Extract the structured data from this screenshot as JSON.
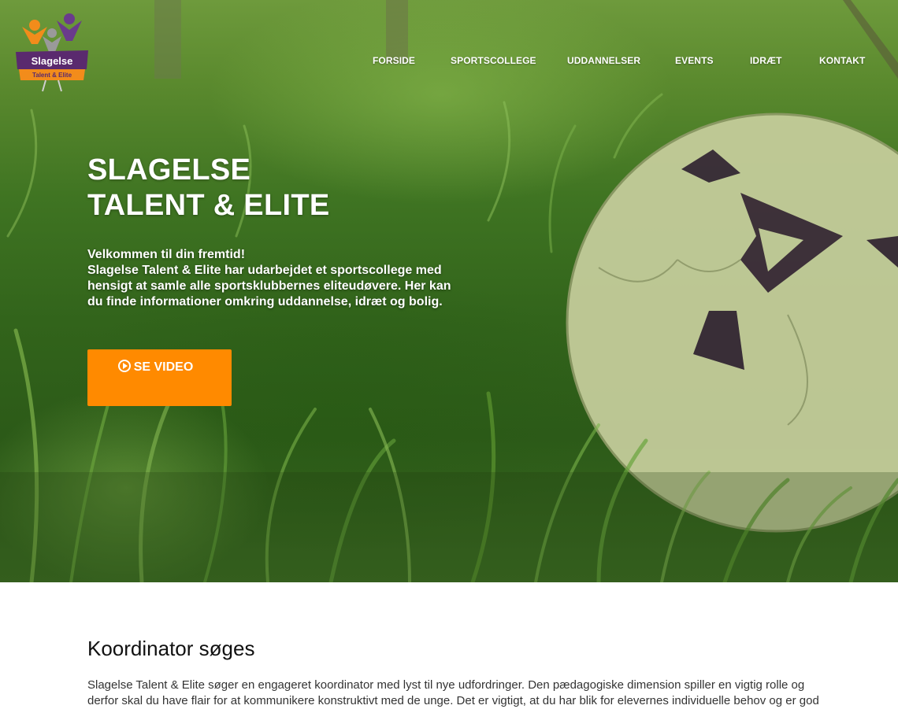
{
  "brand": {
    "logo_name": "Slagelse",
    "logo_sub": "Talent & Elite"
  },
  "nav": {
    "items": [
      {
        "label": "FORSIDE"
      },
      {
        "label": "SPORTSCOLLEGE"
      },
      {
        "label": "UDDANNELSER"
      },
      {
        "label": "EVENTS"
      },
      {
        "label": "IDRÆT"
      },
      {
        "label": "KONTAKT"
      }
    ]
  },
  "hero": {
    "title_line1": "SLAGELSE",
    "title_line2": "TALENT & ELITE",
    "text_line1": "Velkommen til din fremtid!",
    "text_line2": "Slagelse Talent & Elite har udarbejdet et sportscollege med hensigt at samle alle sportsklubbernes eliteudøvere. Her kan du finde informationer omkring uddannelse, idræt og bolig.",
    "button_label": "SE VIDEO",
    "button_icon": "play-circle-icon",
    "button_color": "#ff8a00"
  },
  "section": {
    "title": "Koordinator søges",
    "text": "Slagelse Talent & Elite søger en engageret koordinator med lyst til nye udfordringer. Den pædagogiske dimension spiller en vigtig rolle og derfor skal du have flair for at kommunikere konstruktivt med de unge. Det er vigtigt, at du har blik for elevernes individuelle behov og er god"
  },
  "colors": {
    "accent": "#ff8a00",
    "logo_purple": "#5a2a6e",
    "grass": "#3f7422"
  }
}
